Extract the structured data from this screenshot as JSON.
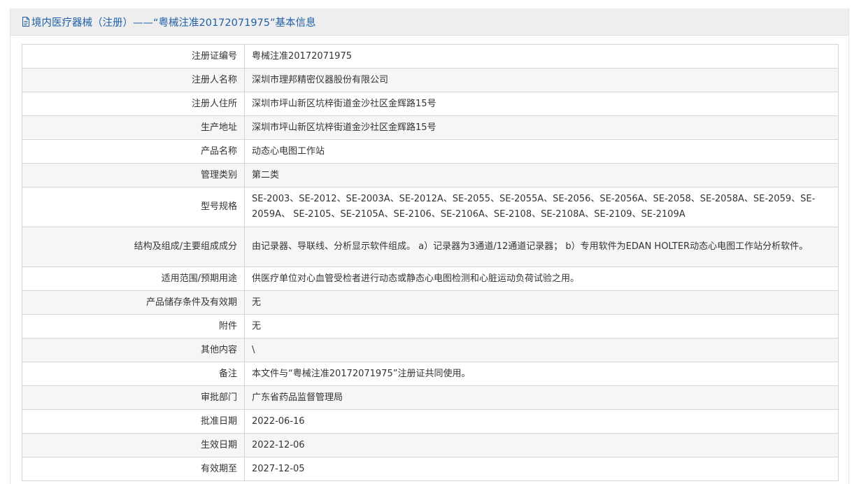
{
  "header": {
    "title": "境内医疗器械（注册）——“粤械注准20172071975”基本信息"
  },
  "rows": [
    {
      "label": "注册证编号",
      "value": "粤械注准20172071975"
    },
    {
      "label": "注册人名称",
      "value": "深圳市理邦精密仪器股份有限公司"
    },
    {
      "label": "注册人住所",
      "value": "深圳市坪山新区坑梓街道金沙社区金辉路15号"
    },
    {
      "label": "生产地址",
      "value": "深圳市坪山新区坑梓街道金沙社区金辉路15号"
    },
    {
      "label": "产品名称",
      "value": "动态心电图工作站"
    },
    {
      "label": "管理类别",
      "value": "第二类"
    },
    {
      "label": "型号规格",
      "value": "SE-2003、SE-2012、SE-2003A、SE-2012A、SE-2055、SE-2055A、SE-2056、SE-2056A、SE-2058、SE-2058A、SE-2059、SE-2059A、 SE-2105、SE-2105A、SE-2106、SE-2106A、SE-2108、SE-2108A、SE-2109、SE-2109A"
    },
    {
      "label": "结构及组成/主要组成成分",
      "value": "由记录器、导联线、分析显示软件组成。 a）记录器为3通道/12通道记录器； b）专用软件为EDAN HOLTER动态心电图工作站分析软件。"
    },
    {
      "label": "适用范围/预期用途",
      "value": "供医疗单位对心血管受检者进行动态或静态心电图检测和心脏运动负荷试验之用。"
    },
    {
      "label": "产品储存条件及有效期",
      "value": "无"
    },
    {
      "label": "附件",
      "value": "无"
    },
    {
      "label": "其他内容",
      "value": "\\"
    },
    {
      "label": "备注",
      "value": "本文件与“粤械注准20172071975”注册证共同使用。"
    },
    {
      "label": "审批部门",
      "value": "广东省药品监督管理局"
    },
    {
      "label": "批准日期",
      "value": "2022-06-16"
    },
    {
      "label": "生效日期",
      "value": "2022-12-06"
    },
    {
      "label": "有效期至",
      "value": "2027-12-05"
    }
  ],
  "colors": {
    "title": "#1e5fa8",
    "header_bg": "#eeeeee",
    "row_alt_bg": "#f6f6f6",
    "border": "#d6d6d6",
    "text": "#333333"
  },
  "icons": {
    "title_icon": "document-icon"
  }
}
